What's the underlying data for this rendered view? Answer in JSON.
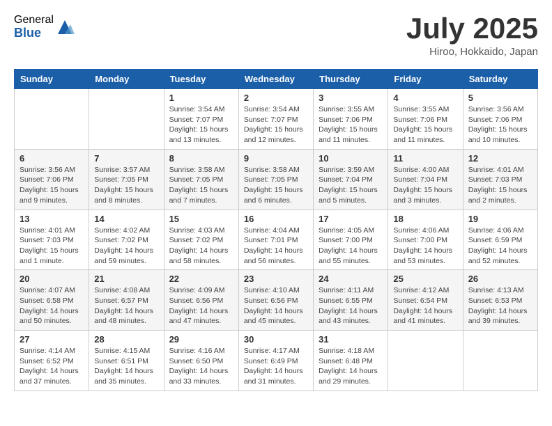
{
  "logo": {
    "general": "General",
    "blue": "Blue"
  },
  "title": "July 2025",
  "location": "Hiroo, Hokkaido, Japan",
  "weekdays": [
    "Sunday",
    "Monday",
    "Tuesday",
    "Wednesday",
    "Thursday",
    "Friday",
    "Saturday"
  ],
  "weeks": [
    [
      {
        "day": "",
        "info": ""
      },
      {
        "day": "",
        "info": ""
      },
      {
        "day": "1",
        "info": "Sunrise: 3:54 AM\nSunset: 7:07 PM\nDaylight: 15 hours and 13 minutes."
      },
      {
        "day": "2",
        "info": "Sunrise: 3:54 AM\nSunset: 7:07 PM\nDaylight: 15 hours and 12 minutes."
      },
      {
        "day": "3",
        "info": "Sunrise: 3:55 AM\nSunset: 7:06 PM\nDaylight: 15 hours and 11 minutes."
      },
      {
        "day": "4",
        "info": "Sunrise: 3:55 AM\nSunset: 7:06 PM\nDaylight: 15 hours and 11 minutes."
      },
      {
        "day": "5",
        "info": "Sunrise: 3:56 AM\nSunset: 7:06 PM\nDaylight: 15 hours and 10 minutes."
      }
    ],
    [
      {
        "day": "6",
        "info": "Sunrise: 3:56 AM\nSunset: 7:06 PM\nDaylight: 15 hours and 9 minutes."
      },
      {
        "day": "7",
        "info": "Sunrise: 3:57 AM\nSunset: 7:05 PM\nDaylight: 15 hours and 8 minutes."
      },
      {
        "day": "8",
        "info": "Sunrise: 3:58 AM\nSunset: 7:05 PM\nDaylight: 15 hours and 7 minutes."
      },
      {
        "day": "9",
        "info": "Sunrise: 3:58 AM\nSunset: 7:05 PM\nDaylight: 15 hours and 6 minutes."
      },
      {
        "day": "10",
        "info": "Sunrise: 3:59 AM\nSunset: 7:04 PM\nDaylight: 15 hours and 5 minutes."
      },
      {
        "day": "11",
        "info": "Sunrise: 4:00 AM\nSunset: 7:04 PM\nDaylight: 15 hours and 3 minutes."
      },
      {
        "day": "12",
        "info": "Sunrise: 4:01 AM\nSunset: 7:03 PM\nDaylight: 15 hours and 2 minutes."
      }
    ],
    [
      {
        "day": "13",
        "info": "Sunrise: 4:01 AM\nSunset: 7:03 PM\nDaylight: 15 hours and 1 minute."
      },
      {
        "day": "14",
        "info": "Sunrise: 4:02 AM\nSunset: 7:02 PM\nDaylight: 14 hours and 59 minutes."
      },
      {
        "day": "15",
        "info": "Sunrise: 4:03 AM\nSunset: 7:02 PM\nDaylight: 14 hours and 58 minutes."
      },
      {
        "day": "16",
        "info": "Sunrise: 4:04 AM\nSunset: 7:01 PM\nDaylight: 14 hours and 56 minutes."
      },
      {
        "day": "17",
        "info": "Sunrise: 4:05 AM\nSunset: 7:00 PM\nDaylight: 14 hours and 55 minutes."
      },
      {
        "day": "18",
        "info": "Sunrise: 4:06 AM\nSunset: 7:00 PM\nDaylight: 14 hours and 53 minutes."
      },
      {
        "day": "19",
        "info": "Sunrise: 4:06 AM\nSunset: 6:59 PM\nDaylight: 14 hours and 52 minutes."
      }
    ],
    [
      {
        "day": "20",
        "info": "Sunrise: 4:07 AM\nSunset: 6:58 PM\nDaylight: 14 hours and 50 minutes."
      },
      {
        "day": "21",
        "info": "Sunrise: 4:08 AM\nSunset: 6:57 PM\nDaylight: 14 hours and 48 minutes."
      },
      {
        "day": "22",
        "info": "Sunrise: 4:09 AM\nSunset: 6:56 PM\nDaylight: 14 hours and 47 minutes."
      },
      {
        "day": "23",
        "info": "Sunrise: 4:10 AM\nSunset: 6:56 PM\nDaylight: 14 hours and 45 minutes."
      },
      {
        "day": "24",
        "info": "Sunrise: 4:11 AM\nSunset: 6:55 PM\nDaylight: 14 hours and 43 minutes."
      },
      {
        "day": "25",
        "info": "Sunrise: 4:12 AM\nSunset: 6:54 PM\nDaylight: 14 hours and 41 minutes."
      },
      {
        "day": "26",
        "info": "Sunrise: 4:13 AM\nSunset: 6:53 PM\nDaylight: 14 hours and 39 minutes."
      }
    ],
    [
      {
        "day": "27",
        "info": "Sunrise: 4:14 AM\nSunset: 6:52 PM\nDaylight: 14 hours and 37 minutes."
      },
      {
        "day": "28",
        "info": "Sunrise: 4:15 AM\nSunset: 6:51 PM\nDaylight: 14 hours and 35 minutes."
      },
      {
        "day": "29",
        "info": "Sunrise: 4:16 AM\nSunset: 6:50 PM\nDaylight: 14 hours and 33 minutes."
      },
      {
        "day": "30",
        "info": "Sunrise: 4:17 AM\nSunset: 6:49 PM\nDaylight: 14 hours and 31 minutes."
      },
      {
        "day": "31",
        "info": "Sunrise: 4:18 AM\nSunset: 6:48 PM\nDaylight: 14 hours and 29 minutes."
      },
      {
        "day": "",
        "info": ""
      },
      {
        "day": "",
        "info": ""
      }
    ]
  ]
}
